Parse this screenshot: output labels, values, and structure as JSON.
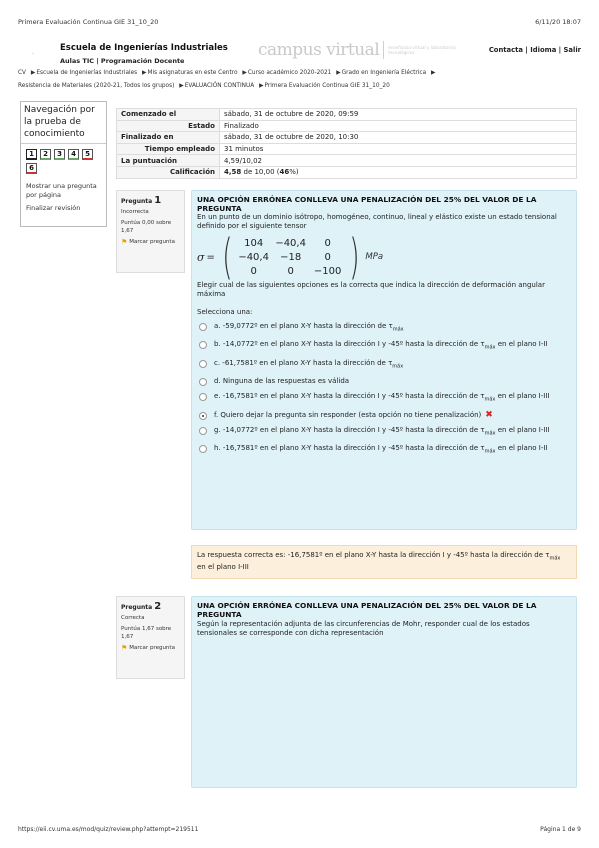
{
  "print_header": {
    "title": "Primera Evaluación Continua GIE 31_10_20",
    "datetime": "6/11/20 18:07"
  },
  "site": {
    "dot": ".",
    "school": "Escuela de Ingenierías Industriales",
    "sublinks": "Aulas TIC | Programación Docente",
    "logo_word": "campus virtual",
    "logo_sub": "enseñanza virtual y laboratorios tecnológicos",
    "toplinks": "Contacta | Idioma | Salir"
  },
  "breadcrumb": {
    "line1": [
      "CV",
      "Escuela de Ingenierías Industriales",
      "Mis asignaturas en este Centro",
      "Curso académico 2020-2021",
      "Grado en Ingeniería Eléctrica"
    ],
    "line2": [
      "Resistencia de Materiales (2020-21, Todos los grupos)",
      "EVALUACIÓN CONTINUA",
      "Primera Evaluación Continua GIE 31_10_20"
    ]
  },
  "nav": {
    "title": "Navegación por la prueba de conocimiento",
    "buttons": [
      "1",
      "2",
      "3",
      "4",
      "5",
      "6"
    ],
    "show_one_page": "Mostrar una pregunta por página",
    "finish_review": "Finalizar revisión"
  },
  "summary": {
    "started_label": "Comenzado el",
    "started_value": "sábado, 31 de octubre de 2020, 09:59",
    "state_label": "Estado",
    "state_value": "Finalizado",
    "finished_label": "Finalizado en",
    "finished_value": "sábado, 31 de octubre de 2020, 10:30",
    "time_label": "Tiempo empleado",
    "time_value": "31 minutos",
    "score_label": "La puntuación",
    "score_value": "4,59/10,02",
    "grade_label": "Calificación",
    "grade_value_bold": "4,58",
    "grade_value_rest": " de 10,00 (",
    "grade_pct": "46",
    "grade_end": "%)"
  },
  "q1": {
    "label": "Pregunta",
    "number": "1",
    "state": "Incorrecta",
    "grade": "Puntúa 0,00 sobre 1,67",
    "flag": "Marcar pregunta",
    "title": "UNA OPCIÓN ERRÓNEA CONLLEVA UNA PENALIZACIÓN DEL 25% DEL VALOR DE LA PREGUNTA",
    "intro": "En un punto de un dominio isótropo, homogéneo, continuo, lineal y elástico existe un estado tensional definido por el siguiente tensor",
    "sigma": "σ",
    "equals": "=",
    "matrix": [
      "104",
      "−40,4",
      "0",
      "−40,4",
      "−18",
      "0",
      "0",
      "0",
      "−100"
    ],
    "unit": "MPa",
    "question": "Elegir cual de las siguientes opciones es la correcta que indica la dirección de deformación angular máxima",
    "select_one": "Selecciona una:",
    "options": [
      {
        "pre": "a. -59,0772º en el plano X-Y hasta la dirección de τ",
        "sub": "máx",
        "post": ""
      },
      {
        "pre": "b. -14,0772º en el plano X-Y hasta la dirección I y -45º hasta la dirección de τ",
        "sub": "máx",
        "post": " en el plano I-II"
      },
      {
        "pre": "c. -61,7581º en el plano X-Y hasta la dirección de τ",
        "sub": "máx",
        "post": ""
      },
      {
        "pre": "d. Ninguna de las respuestas es válida",
        "sub": "",
        "post": ""
      },
      {
        "pre": "e. -16,7581º en el plano X-Y hasta la dirección I y -45º hasta la dirección de τ",
        "sub": "máx",
        "post": " en el plano I-III"
      },
      {
        "pre": "f. Quiero dejar la pregunta sin responder (esta opción no tiene penalización)",
        "sub": "",
        "post": ""
      },
      {
        "pre": "g. -14,0772º en el plano X-Y hasta la dirección I y -45º hasta la dirección de τ",
        "sub": "máx",
        "post": " en el plano I-III"
      },
      {
        "pre": "h. -16,7581º en el plano X-Y hasta la dirección I y -45º hasta la dirección de τ",
        "sub": "máx",
        "post": " en el plano I-II"
      }
    ],
    "wrong_mark": "✖",
    "feedback_pre": "La respuesta correcta es: -16,7581º en el plano X-Y hasta la dirección I y -45º hasta la dirección de τ",
    "feedback_sub": "máx",
    "feedback_post": " en el plano I-III"
  },
  "q2": {
    "label": "Pregunta",
    "number": "2",
    "state": "Correcta",
    "grade": "Puntúa 1,67 sobre 1,67",
    "flag": "Marcar pregunta",
    "title": "UNA OPCIÓN ERRÓNEA CONLLEVA UNA PENALIZACIÓN DEL 25% DEL VALOR DE LA PREGUNTA",
    "text": "Según la representación adjunta de las circunferencias de Mohr, responder cual de los estados tensionales se corresponde con dicha representación"
  },
  "print_footer": {
    "url": "https://eii.cv.uma.es/mod/quiz/review.php?attempt=219511",
    "page": "Página 1 de 9"
  }
}
